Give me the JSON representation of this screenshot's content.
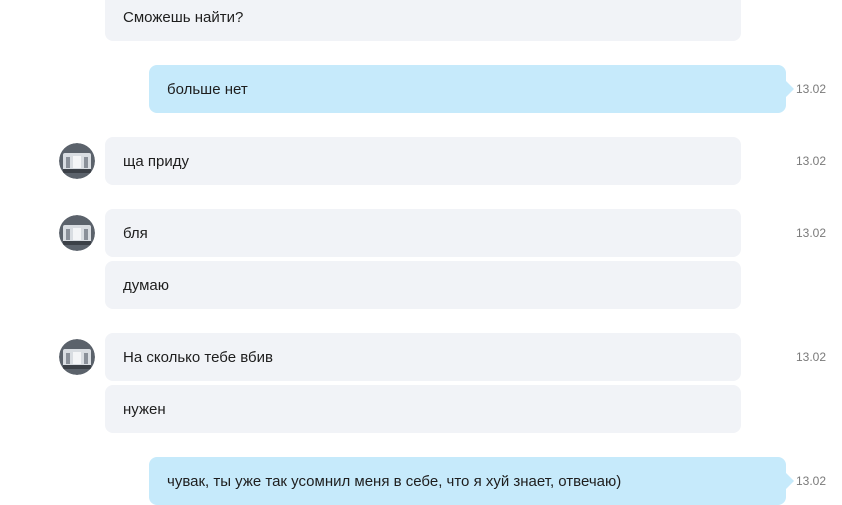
{
  "messages": [
    {
      "text": "Сможешь найти?"
    },
    {
      "text": "больше нет",
      "time": "13.02"
    },
    {
      "text": "ща приду",
      "time": "13.02"
    },
    {
      "text": "бля",
      "time": "13.02"
    },
    {
      "text": "думаю"
    },
    {
      "text": "На сколько тебе вбив",
      "time": "13.02"
    },
    {
      "text": "нужен"
    },
    {
      "text": "чувак, ты уже так усомнил меня в себе, что я хуй знает, отвечаю)",
      "time": "13.02"
    }
  ],
  "avatar": {
    "icon": "contact-avatar"
  },
  "colors": {
    "incoming": "#f1f3f7",
    "outgoing": "#c6eafb",
    "timestamp": "#7a7a7a"
  }
}
